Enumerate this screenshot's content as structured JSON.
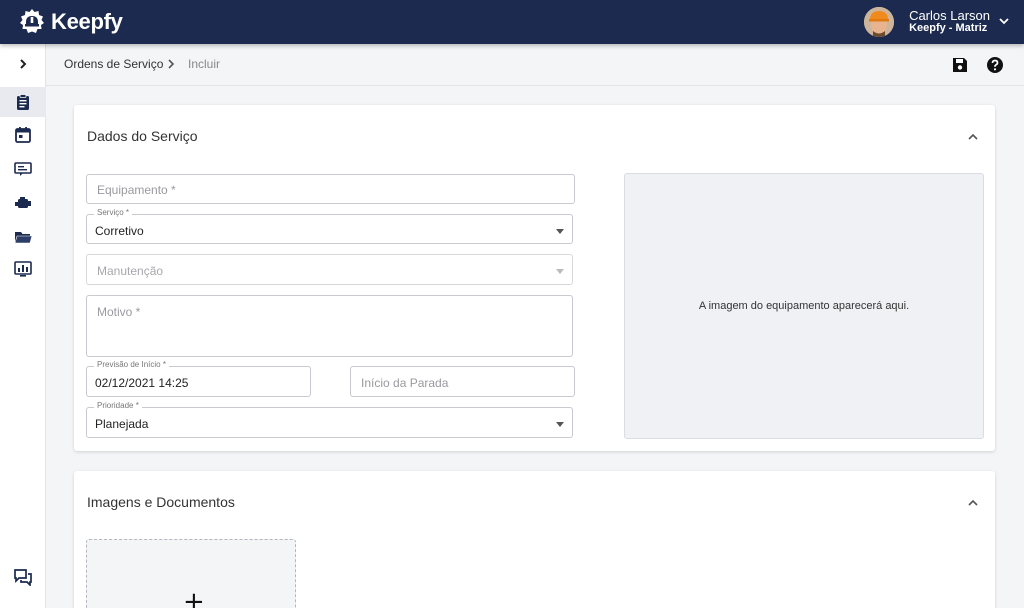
{
  "app": {
    "name": "Keepfy"
  },
  "user": {
    "name": "Carlos Larson",
    "org": "Keepfy - Matriz"
  },
  "breadcrumb": {
    "parent": "Ordens de Serviço",
    "current": "Incluir"
  },
  "sidebar": {
    "items": [
      {
        "icon": "clipboard-icon",
        "active": true
      },
      {
        "icon": "calendar-icon",
        "active": false
      },
      {
        "icon": "ticket-icon",
        "active": false
      },
      {
        "icon": "engine-icon",
        "active": false
      },
      {
        "icon": "folder-icon",
        "active": false
      },
      {
        "icon": "dashboard-icon",
        "active": false
      }
    ],
    "chat_icon": "chat-icon"
  },
  "service_card": {
    "title": "Dados do Serviço",
    "equipamento": {
      "placeholder": "Equipamento *",
      "value": ""
    },
    "servico": {
      "label": "Serviço *",
      "value": "Corretivo"
    },
    "manutencao": {
      "placeholder": "Manutenção",
      "value": ""
    },
    "motivo": {
      "placeholder": "Motivo *",
      "value": ""
    },
    "previsao": {
      "label": "Previsão de Início *",
      "value": "02/12/2021 14:25"
    },
    "inicio_parada": {
      "placeholder": "Início da Parada",
      "value": ""
    },
    "prioridade": {
      "label": "Prioridade *",
      "value": "Planejada"
    },
    "image_placeholder": "A imagem do equipamento aparecerá aqui."
  },
  "docs_card": {
    "title": "Imagens e Documentos",
    "add_symbol": "+"
  },
  "colors": {
    "topbar": "#1b2a4e",
    "sidebar": "#ffffff",
    "background": "#f4f5f7"
  }
}
